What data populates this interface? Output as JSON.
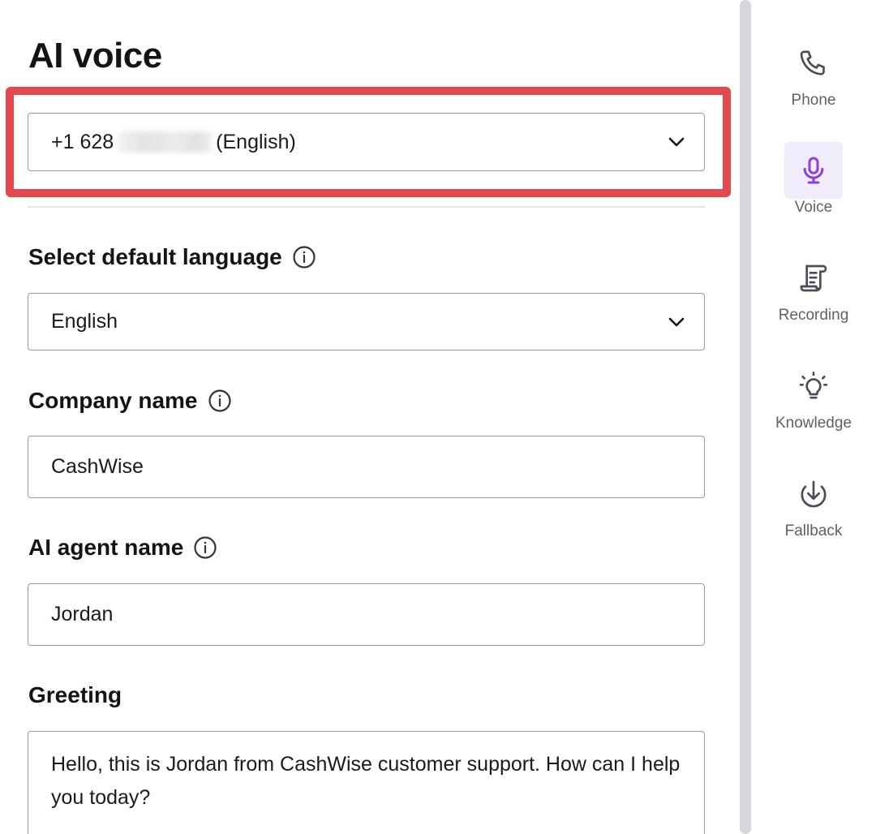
{
  "page": {
    "title": "AI voice"
  },
  "phone_select": {
    "prefix": "+1 628",
    "suffix": "(English)"
  },
  "language": {
    "label": "Select default language",
    "value": "English"
  },
  "company": {
    "label": "Company name",
    "value": "CashWise"
  },
  "agent": {
    "label": "AI agent name",
    "value": "Jordan"
  },
  "greeting": {
    "label": "Greeting",
    "value": "Hello, this is Jordan from CashWise customer support. How can I help you today?"
  },
  "rail": {
    "items": [
      {
        "label": "Phone",
        "icon": "phone-icon"
      },
      {
        "label": "Voice",
        "icon": "microphone-icon",
        "active": true
      },
      {
        "label": "Recording",
        "icon": "scroll-icon"
      },
      {
        "label": "Knowledge",
        "icon": "lightbulb-icon"
      },
      {
        "label": "Fallback",
        "icon": "download-circle-icon"
      }
    ]
  },
  "colors": {
    "highlight": "#e4474d",
    "accent": "#8a3fe0",
    "active_bg": "#f1ecfb",
    "rail_text": "#5e6168"
  }
}
